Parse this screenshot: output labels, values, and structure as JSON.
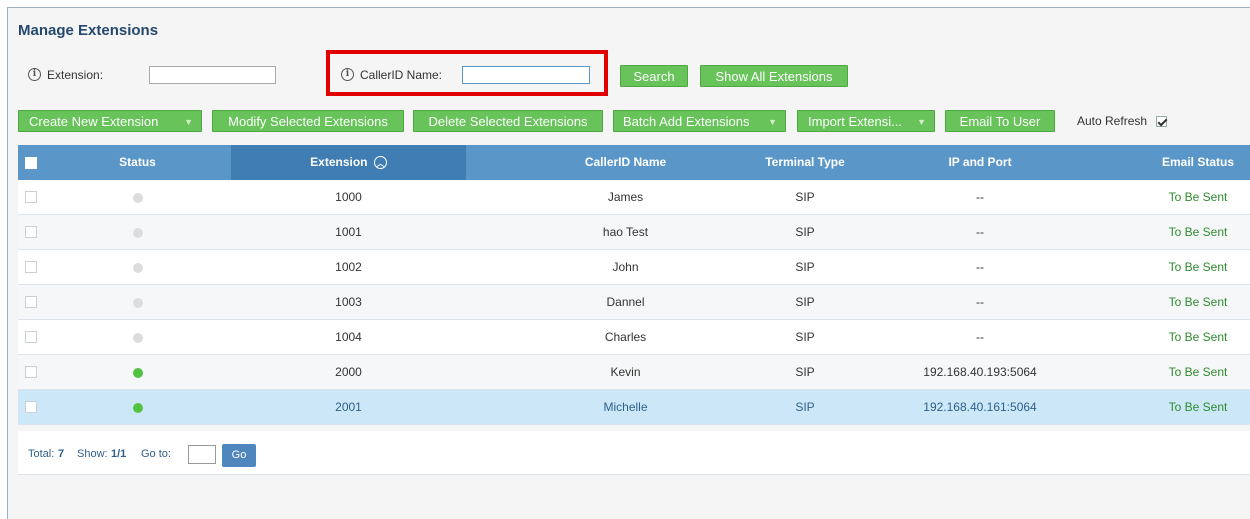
{
  "page_title": "Manage Extensions",
  "filters": {
    "extension_label": "Extension:",
    "extension_value": "",
    "callerid_label": "CallerID Name:",
    "callerid_value": "",
    "info_icon_glyph": "i"
  },
  "buttons": {
    "search": "Search",
    "show_all": "Show All Extensions",
    "create_new": "Create New Extension",
    "modify_selected": "Modify Selected Extensions",
    "delete_selected": "Delete Selected Extensions",
    "batch_add": "Batch Add Extensions",
    "import": "Import Extensi...",
    "email_to_user": "Email To User",
    "caret_glyph": "▼"
  },
  "auto_refresh": {
    "label": "Auto Refresh",
    "checked": true
  },
  "table": {
    "columns": {
      "status": "Status",
      "extension": "Extension",
      "extension_sort_glyph": "︿",
      "callerid": "CallerID Name",
      "terminal_type": "Terminal Type",
      "ip_port": "IP and Port",
      "email_status": "Email Status"
    },
    "rows": [
      {
        "status": "offline",
        "extension": "1000",
        "callerid": "James",
        "terminal_type": "SIP",
        "ip_port": "--",
        "email_status": "To Be Sent",
        "selected": false
      },
      {
        "status": "offline",
        "extension": "1001",
        "callerid": "hao Test",
        "terminal_type": "SIP",
        "ip_port": "--",
        "email_status": "To Be Sent",
        "selected": false
      },
      {
        "status": "offline",
        "extension": "1002",
        "callerid": "John",
        "terminal_type": "SIP",
        "ip_port": "--",
        "email_status": "To Be Sent",
        "selected": false
      },
      {
        "status": "offline",
        "extension": "1003",
        "callerid": "Dannel",
        "terminal_type": "SIP",
        "ip_port": "--",
        "email_status": "To Be Sent",
        "selected": false
      },
      {
        "status": "offline",
        "extension": "1004",
        "callerid": "Charles",
        "terminal_type": "SIP",
        "ip_port": "--",
        "email_status": "To Be Sent",
        "selected": false
      },
      {
        "status": "online",
        "extension": "2000",
        "callerid": "Kevin",
        "terminal_type": "SIP",
        "ip_port": "192.168.40.193:5064",
        "email_status": "To Be Sent",
        "selected": false
      },
      {
        "status": "online",
        "extension": "2001",
        "callerid": "Michelle",
        "terminal_type": "SIP",
        "ip_port": "192.168.40.161:5064",
        "email_status": "To Be Sent",
        "selected": true
      }
    ]
  },
  "pager": {
    "total_label": "Total:",
    "total_value": "7",
    "show_label": "Show:",
    "show_value": "1/1",
    "goto_label": "Go to:",
    "goto_value": "",
    "go_button": "Go"
  },
  "colors": {
    "status_online": "#52c241",
    "status_offline": "#dcdcdc",
    "accent_green": "#67c35a",
    "header_blue": "#5a97c8",
    "highlight_red": "#e00000"
  }
}
